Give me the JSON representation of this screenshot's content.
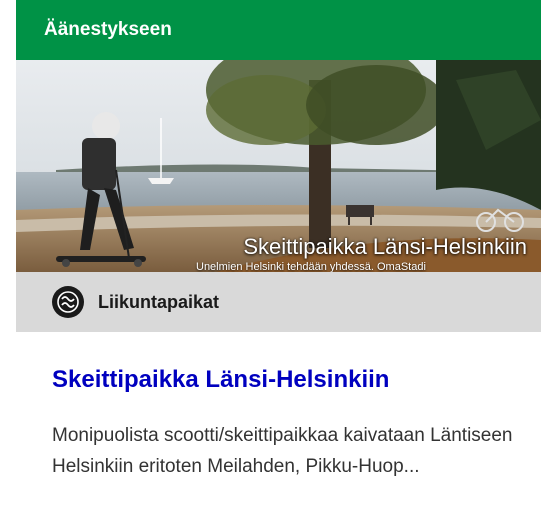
{
  "card": {
    "status_label": "Äänestykseen",
    "image_caption": "Skeittipaikka Länsi-Helsinkiin",
    "image_subcaption": "Unelmien Helsinki tehdään yhdessä. OmaStadi",
    "category": {
      "label": "Liikuntapaikat",
      "icon": "sports-category-icon"
    },
    "title": "Skeittipaikka Länsi-Helsinkiin",
    "description": "Monipuolista scootti/skeittipaikkaa kaivataan Läntiseen Helsinkiin eritoten Meilahden, Pikku-Huop..."
  },
  "colors": {
    "status_green": "#009246",
    "title_blue": "#0000bf",
    "category_gray": "#d9d9d9",
    "text": "#333333"
  }
}
